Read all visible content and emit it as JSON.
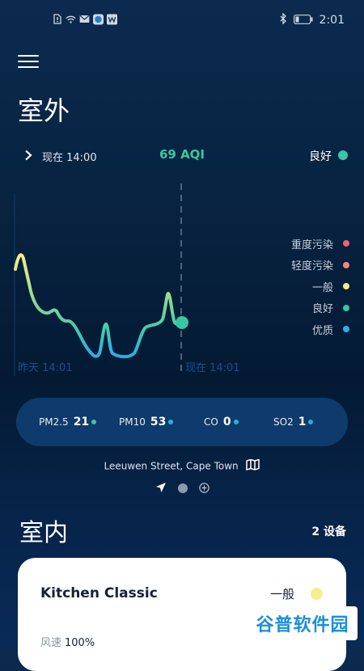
{
  "status_bar": {
    "time": "2:01"
  },
  "header": {
    "title": "室外"
  },
  "info": {
    "now_time": "现在 14:00",
    "aqi": "69 AQI",
    "status": "良好",
    "status_color": "#38c7a2"
  },
  "chart": {
    "start_label": "昨天 14:01",
    "end_label": "现在 14:01",
    "legend": [
      {
        "label": "重度污染",
        "color": "#f0616e"
      },
      {
        "label": "轻度污染",
        "color": "#f08a77"
      },
      {
        "label": "一般",
        "color": "#f4ec84"
      },
      {
        "label": "良好",
        "color": "#38c7a2"
      },
      {
        "label": "优质",
        "color": "#2aaee6"
      }
    ]
  },
  "pollutants": [
    {
      "name": "PM2.5",
      "value": "21",
      "color": "#38c7a2"
    },
    {
      "name": "PM10",
      "value": "53",
      "color": "#2aaee6"
    },
    {
      "name": "CO",
      "value": "0",
      "color": "#2aaee6"
    },
    {
      "name": "SO2",
      "value": "1",
      "color": "#2aaee6"
    }
  ],
  "location": {
    "name": "Leeuwen Street, Cape Town"
  },
  "indoor": {
    "title": "室内",
    "device_count": "2 设备"
  },
  "device": {
    "name": "Kitchen Classic",
    "status": "一般",
    "fan_label": "风速",
    "fan_value": "100%"
  },
  "watermark": {
    "text": "谷普软件园"
  }
}
